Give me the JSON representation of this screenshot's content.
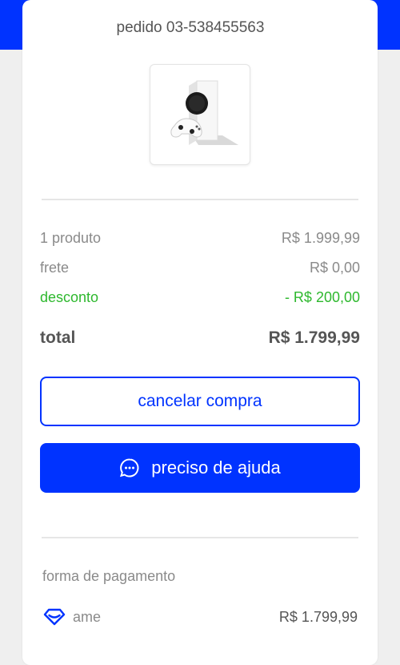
{
  "order": {
    "label": "pedido 03-538455563"
  },
  "product_image": {
    "icon": "xbox-series-s-console-image"
  },
  "summary": {
    "products_label": "1 produto",
    "products_value": "R$ 1.999,99",
    "shipping_label": "frete",
    "shipping_value": "R$ 0,00",
    "discount_label": "desconto",
    "discount_value": "- R$ 200,00",
    "total_label": "total",
    "total_value": "R$ 1.799,99"
  },
  "actions": {
    "cancel_label": "cancelar compra",
    "help_label": "preciso de ajuda",
    "help_icon": "chat-bubble-icon"
  },
  "payment": {
    "section_title": "forma de pagamento",
    "method_icon": "ame-heart-icon",
    "method_label": "ame",
    "amount": "R$ 1.799,99"
  },
  "colors": {
    "brand_blue": "#0033ff",
    "discount_green": "#2eb82e",
    "muted_text": "#8a8a8a",
    "dark_text": "#555555"
  }
}
